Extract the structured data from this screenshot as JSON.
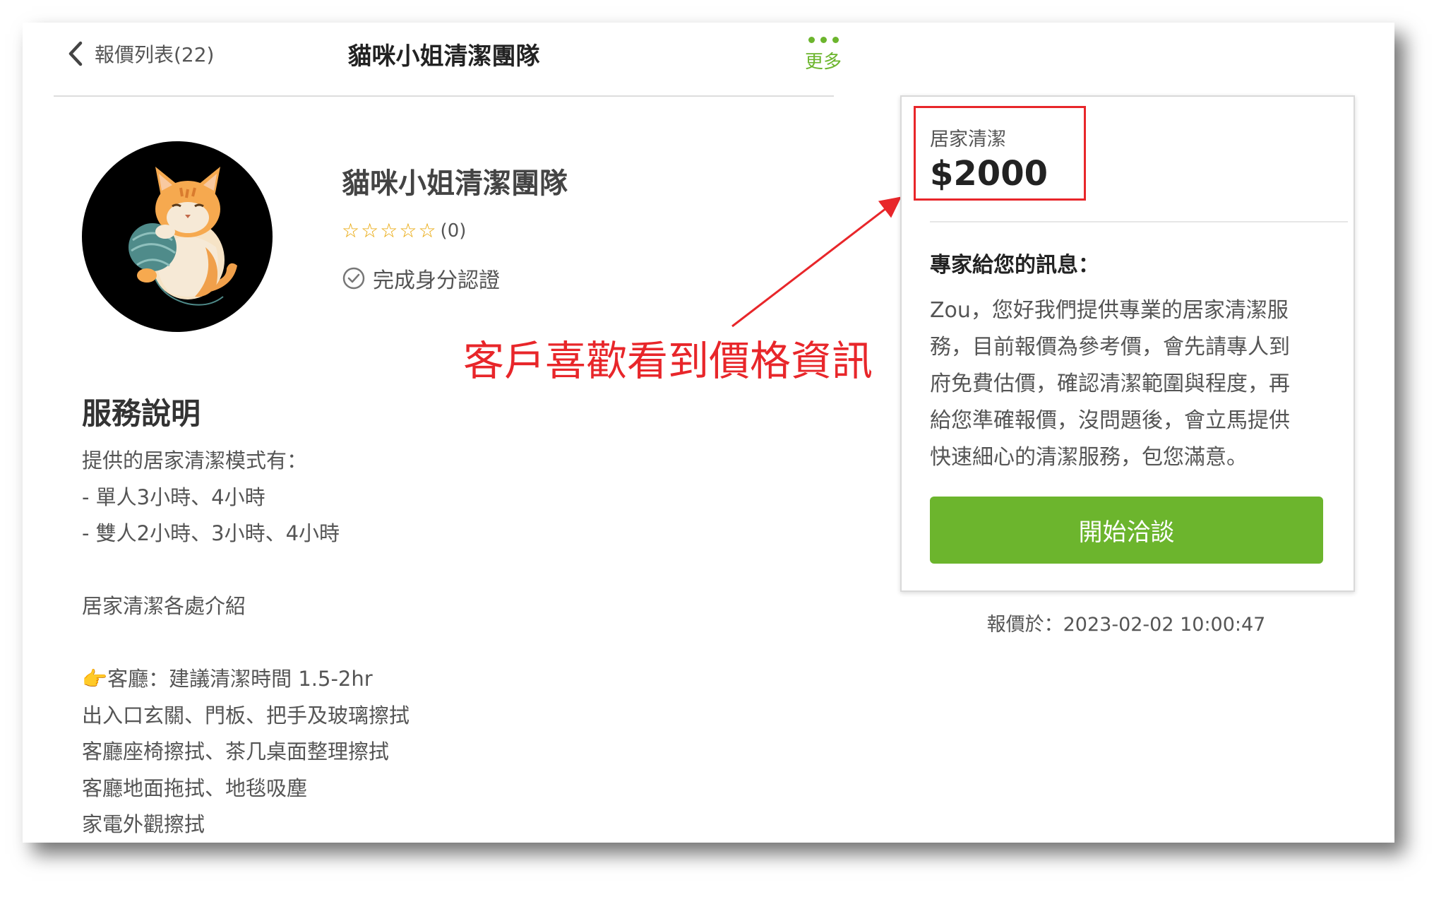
{
  "header": {
    "back_label": "報價列表(22)",
    "title": "貓咪小姐清潔團隊",
    "more_label": "更多"
  },
  "profile": {
    "name": "貓咪小姐清潔團隊",
    "rating_stars": 0,
    "rating_count": "(0)",
    "verified_label": "完成身分認證"
  },
  "service": {
    "heading": "服務說明",
    "lines": [
      "提供的居家清潔模式有：",
      "- 單人3小時、4小時",
      "- 雙人2小時、3小時、4小時",
      "",
      "居家清潔各處介紹",
      "",
      "👉客廳：建議清潔時間 1.5-2hr",
      "出入口玄關、門板、把手及玻璃擦拭",
      "客廳座椅擦拭、茶几桌面整理擦拭",
      "客廳地面拖拭、地毯吸塵",
      "家電外觀擦拭"
    ]
  },
  "annotation": {
    "text": "客戶喜歡看到價格資訊",
    "color": "#e8262a"
  },
  "quote": {
    "service_type": "居家清潔",
    "price": "$2000",
    "message_heading": "專家給您的訊息：",
    "message_lines": [
      "Zou，您好我們提供專業的居家清潔服",
      "務，目前報價為參考價，會先請專人到",
      "府免費估價，確認清潔範圍與程度，再",
      "給您準確報價，沒問題後，會立馬提供",
      "快速細心的清潔服務，包您滿意。"
    ],
    "cta_label": "開始洽談",
    "quoted_at": "報價於：2023-02-02 10:00:47"
  },
  "colors": {
    "accent_green": "#6cb52d",
    "highlight_red": "#e8262a",
    "star": "#e8a400"
  },
  "icons": {
    "back": "chevron-left-icon",
    "more": "more-dots-icon",
    "verified": "check-circle-icon",
    "star": "star-outline-icon"
  }
}
